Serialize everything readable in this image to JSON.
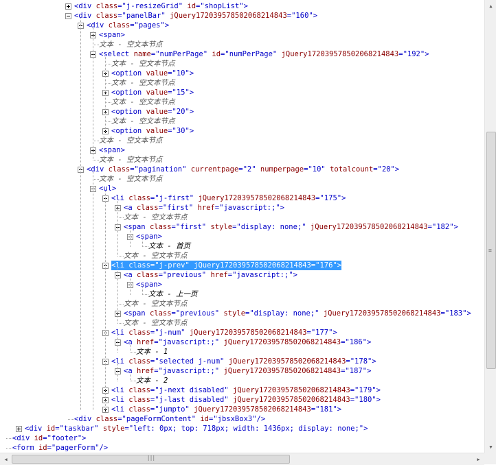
{
  "tree_rows": [
    {
      "d": 5,
      "btn": "col",
      "p": [
        [
          "tg",
          "<div "
        ],
        [
          "an",
          "class"
        ],
        [
          "tg",
          "="
        ],
        [
          "av",
          "\"j-resizeGrid\""
        ],
        [
          "tg",
          " "
        ],
        [
          "an",
          "id"
        ],
        [
          "tg",
          "="
        ],
        [
          "av",
          "\"shopList\""
        ],
        [
          "tg",
          ">"
        ]
      ]
    },
    {
      "d": 5,
      "btn": "exp",
      "p": [
        [
          "tg",
          "<div "
        ],
        [
          "an",
          "class"
        ],
        [
          "tg",
          "="
        ],
        [
          "av",
          "\"panelBar\""
        ],
        [
          "tg",
          " "
        ],
        [
          "an",
          "jQuery172039578502068214843"
        ],
        [
          "tg",
          "="
        ],
        [
          "av",
          "\"160\""
        ],
        [
          "tg",
          ">"
        ]
      ]
    },
    {
      "d": 6,
      "btn": "exp",
      "p": [
        [
          "tg",
          "<div "
        ],
        [
          "an",
          "class"
        ],
        [
          "tg",
          "="
        ],
        [
          "av",
          "\"pages\""
        ],
        [
          "tg",
          ">"
        ]
      ]
    },
    {
      "d": 7,
      "btn": "col",
      "p": [
        [
          "tg",
          "<span>"
        ]
      ]
    },
    {
      "d": 7,
      "btn": "",
      "p": [
        [
          "tn",
          "文本 - 空文本节点"
        ]
      ]
    },
    {
      "d": 7,
      "btn": "exp",
      "p": [
        [
          "tg",
          "<select "
        ],
        [
          "an",
          "name"
        ],
        [
          "tg",
          "="
        ],
        [
          "av",
          "\"numPerPage\""
        ],
        [
          "tg",
          " "
        ],
        [
          "an",
          "id"
        ],
        [
          "tg",
          "="
        ],
        [
          "av",
          "\"numPerPage\""
        ],
        [
          "tg",
          " "
        ],
        [
          "an",
          "jQuery172039578502068214843"
        ],
        [
          "tg",
          "="
        ],
        [
          "av",
          "\"192\""
        ],
        [
          "tg",
          ">"
        ]
      ]
    },
    {
      "d": 8,
      "btn": "",
      "p": [
        [
          "tn",
          "文本 - 空文本节点"
        ]
      ]
    },
    {
      "d": 8,
      "btn": "col",
      "p": [
        [
          "tg",
          "<option "
        ],
        [
          "an",
          "value"
        ],
        [
          "tg",
          "="
        ],
        [
          "av",
          "\"10\""
        ],
        [
          "tg",
          ">"
        ]
      ]
    },
    {
      "d": 8,
      "btn": "",
      "p": [
        [
          "tn",
          "文本 - 空文本节点"
        ]
      ]
    },
    {
      "d": 8,
      "btn": "col",
      "p": [
        [
          "tg",
          "<option "
        ],
        [
          "an",
          "value"
        ],
        [
          "tg",
          "="
        ],
        [
          "av",
          "\"15\""
        ],
        [
          "tg",
          ">"
        ]
      ]
    },
    {
      "d": 8,
      "btn": "",
      "p": [
        [
          "tn",
          "文本 - 空文本节点"
        ]
      ]
    },
    {
      "d": 8,
      "btn": "col",
      "p": [
        [
          "tg",
          "<option "
        ],
        [
          "an",
          "value"
        ],
        [
          "tg",
          "="
        ],
        [
          "av",
          "\"20\""
        ],
        [
          "tg",
          ">"
        ]
      ]
    },
    {
      "d": 8,
      "btn": "",
      "p": [
        [
          "tn",
          "文本 - 空文本节点"
        ]
      ]
    },
    {
      "d": 8,
      "btn": "col",
      "p": [
        [
          "tg",
          "<option "
        ],
        [
          "an",
          "value"
        ],
        [
          "tg",
          "="
        ],
        [
          "av",
          "\"30\""
        ],
        [
          "tg",
          ">"
        ]
      ]
    },
    {
      "d": 7,
      "btn": "",
      "p": [
        [
          "tn",
          "文本 - 空文本节点"
        ]
      ]
    },
    {
      "d": 7,
      "btn": "col",
      "p": [
        [
          "tg",
          "<span>"
        ]
      ]
    },
    {
      "d": 7,
      "btn": "",
      "p": [
        [
          "tn",
          "文本 - 空文本节点"
        ]
      ]
    },
    {
      "d": 6,
      "btn": "exp",
      "p": [
        [
          "tg",
          "<div "
        ],
        [
          "an",
          "class"
        ],
        [
          "tg",
          "="
        ],
        [
          "av",
          "\"pagination\""
        ],
        [
          "tg",
          " "
        ],
        [
          "an",
          "currentpage"
        ],
        [
          "tg",
          "="
        ],
        [
          "av",
          "\"2\""
        ],
        [
          "tg",
          " "
        ],
        [
          "an",
          "numperpage"
        ],
        [
          "tg",
          "="
        ],
        [
          "av",
          "\"10\""
        ],
        [
          "tg",
          " "
        ],
        [
          "an",
          "totalcount"
        ],
        [
          "tg",
          "="
        ],
        [
          "av",
          "\"20\""
        ],
        [
          "tg",
          ">"
        ]
      ]
    },
    {
      "d": 7,
      "btn": "",
      "p": [
        [
          "tn",
          "文本 - 空文本节点"
        ]
      ]
    },
    {
      "d": 7,
      "btn": "exp",
      "p": [
        [
          "tg",
          "<ul>"
        ]
      ]
    },
    {
      "d": 8,
      "btn": "exp",
      "p": [
        [
          "tg",
          "<li "
        ],
        [
          "an",
          "class"
        ],
        [
          "tg",
          "="
        ],
        [
          "av",
          "\"j-first\""
        ],
        [
          "tg",
          " "
        ],
        [
          "an",
          "jQuery172039578502068214843"
        ],
        [
          "tg",
          "="
        ],
        [
          "av",
          "\"175\""
        ],
        [
          "tg",
          ">"
        ]
      ]
    },
    {
      "d": 9,
      "btn": "col",
      "p": [
        [
          "tg",
          "<a "
        ],
        [
          "an",
          "class"
        ],
        [
          "tg",
          "="
        ],
        [
          "av",
          "\"first\""
        ],
        [
          "tg",
          " "
        ],
        [
          "an",
          "href"
        ],
        [
          "tg",
          "="
        ],
        [
          "av",
          "\"javascript:;\""
        ],
        [
          "tg",
          ">"
        ]
      ]
    },
    {
      "d": 9,
      "btn": "",
      "p": [
        [
          "tn",
          "文本 - 空文本节点"
        ]
      ]
    },
    {
      "d": 9,
      "btn": "exp",
      "p": [
        [
          "tg",
          "<span "
        ],
        [
          "an",
          "class"
        ],
        [
          "tg",
          "="
        ],
        [
          "av",
          "\"first\""
        ],
        [
          "tg",
          " "
        ],
        [
          "an",
          "style"
        ],
        [
          "tg",
          "="
        ],
        [
          "av",
          "\"display: none;\""
        ],
        [
          "tg",
          " "
        ],
        [
          "an",
          "jQuery172039578502068214843"
        ],
        [
          "tg",
          "="
        ],
        [
          "av",
          "\"182\""
        ],
        [
          "tg",
          ">"
        ]
      ]
    },
    {
      "d": 10,
      "btn": "exp",
      "p": [
        [
          "tg",
          "<span>"
        ]
      ]
    },
    {
      "d": 11,
      "btn": "",
      "p": [
        [
          "tx",
          "文本 - 首页"
        ]
      ]
    },
    {
      "d": 9,
      "btn": "",
      "p": [
        [
          "tn",
          "文本 - 空文本节点"
        ]
      ]
    },
    {
      "d": 8,
      "btn": "exp",
      "sel": true,
      "p": [
        [
          "tg",
          "<li "
        ],
        [
          "an",
          "class"
        ],
        [
          "tg",
          "="
        ],
        [
          "av",
          "\"j-prev\""
        ],
        [
          "tg",
          " "
        ],
        [
          "an",
          "jQuery172039578502068214843"
        ],
        [
          "tg",
          "="
        ],
        [
          "av",
          "\"176\""
        ],
        [
          "tg",
          ">"
        ]
      ]
    },
    {
      "d": 9,
      "btn": "exp",
      "p": [
        [
          "tg",
          "<a "
        ],
        [
          "an",
          "class"
        ],
        [
          "tg",
          "="
        ],
        [
          "av",
          "\"previous\""
        ],
        [
          "tg",
          " "
        ],
        [
          "an",
          "href"
        ],
        [
          "tg",
          "="
        ],
        [
          "av",
          "\"javascript:;\""
        ],
        [
          "tg",
          ">"
        ]
      ]
    },
    {
      "d": 10,
      "btn": "exp",
      "p": [
        [
          "tg",
          "<span>"
        ]
      ]
    },
    {
      "d": 11,
      "btn": "",
      "p": [
        [
          "tx",
          "文本 - 上一页"
        ]
      ]
    },
    {
      "d": 9,
      "btn": "",
      "p": [
        [
          "tn",
          "文本 - 空文本节点"
        ]
      ]
    },
    {
      "d": 9,
      "btn": "col",
      "p": [
        [
          "tg",
          "<span "
        ],
        [
          "an",
          "class"
        ],
        [
          "tg",
          "="
        ],
        [
          "av",
          "\"previous\""
        ],
        [
          "tg",
          " "
        ],
        [
          "an",
          "style"
        ],
        [
          "tg",
          "="
        ],
        [
          "av",
          "\"display: none;\""
        ],
        [
          "tg",
          " "
        ],
        [
          "an",
          "jQuery172039578502068214843"
        ],
        [
          "tg",
          "="
        ],
        [
          "av",
          "\"183\""
        ],
        [
          "tg",
          ">"
        ]
      ]
    },
    {
      "d": 9,
      "btn": "",
      "p": [
        [
          "tn",
          "文本 - 空文本节点"
        ]
      ]
    },
    {
      "d": 8,
      "btn": "exp",
      "p": [
        [
          "tg",
          "<li "
        ],
        [
          "an",
          "class"
        ],
        [
          "tg",
          "="
        ],
        [
          "av",
          "\"j-num\""
        ],
        [
          "tg",
          " "
        ],
        [
          "an",
          "jQuery172039578502068214843"
        ],
        [
          "tg",
          "="
        ],
        [
          "av",
          "\"177\""
        ],
        [
          "tg",
          ">"
        ]
      ]
    },
    {
      "d": 9,
      "btn": "exp",
      "p": [
        [
          "tg",
          "<a "
        ],
        [
          "an",
          "href"
        ],
        [
          "tg",
          "="
        ],
        [
          "av",
          "\"javascript:;\""
        ],
        [
          "tg",
          " "
        ],
        [
          "an",
          "jQuery172039578502068214843"
        ],
        [
          "tg",
          "="
        ],
        [
          "av",
          "\"186\""
        ],
        [
          "tg",
          ">"
        ]
      ]
    },
    {
      "d": 10,
      "btn": "",
      "p": [
        [
          "tx",
          "文本 - 1"
        ]
      ]
    },
    {
      "d": 8,
      "btn": "exp",
      "p": [
        [
          "tg",
          "<li "
        ],
        [
          "an",
          "class"
        ],
        [
          "tg",
          "="
        ],
        [
          "av",
          "\"selected j-num\""
        ],
        [
          "tg",
          " "
        ],
        [
          "an",
          "jQuery172039578502068214843"
        ],
        [
          "tg",
          "="
        ],
        [
          "av",
          "\"178\""
        ],
        [
          "tg",
          ">"
        ]
      ]
    },
    {
      "d": 9,
      "btn": "exp",
      "p": [
        [
          "tg",
          "<a "
        ],
        [
          "an",
          "href"
        ],
        [
          "tg",
          "="
        ],
        [
          "av",
          "\"javascript:;\""
        ],
        [
          "tg",
          " "
        ],
        [
          "an",
          "jQuery172039578502068214843"
        ],
        [
          "tg",
          "="
        ],
        [
          "av",
          "\"187\""
        ],
        [
          "tg",
          ">"
        ]
      ]
    },
    {
      "d": 10,
      "btn": "",
      "p": [
        [
          "tx",
          "文本 - 2"
        ]
      ]
    },
    {
      "d": 8,
      "btn": "col",
      "p": [
        [
          "tg",
          "<li "
        ],
        [
          "an",
          "class"
        ],
        [
          "tg",
          "="
        ],
        [
          "av",
          "\"j-next disabled\""
        ],
        [
          "tg",
          " "
        ],
        [
          "an",
          "jQuery172039578502068214843"
        ],
        [
          "tg",
          "="
        ],
        [
          "av",
          "\"179\""
        ],
        [
          "tg",
          ">"
        ]
      ]
    },
    {
      "d": 8,
      "btn": "col",
      "p": [
        [
          "tg",
          "<li "
        ],
        [
          "an",
          "class"
        ],
        [
          "tg",
          "="
        ],
        [
          "av",
          "\"j-last disabled\""
        ],
        [
          "tg",
          " "
        ],
        [
          "an",
          "jQuery172039578502068214843"
        ],
        [
          "tg",
          "="
        ],
        [
          "av",
          "\"180\""
        ],
        [
          "tg",
          ">"
        ]
      ]
    },
    {
      "d": 8,
      "btn": "col",
      "p": [
        [
          "tg",
          "<li "
        ],
        [
          "an",
          "class"
        ],
        [
          "tg",
          "="
        ],
        [
          "av",
          "\"jumpto\""
        ],
        [
          "tg",
          " "
        ],
        [
          "an",
          "jQuery172039578502068214843"
        ],
        [
          "tg",
          "="
        ],
        [
          "av",
          "\"181\""
        ],
        [
          "tg",
          ">"
        ]
      ]
    },
    {
      "d": 5,
      "btn": "",
      "p": [
        [
          "tg",
          "<div "
        ],
        [
          "an",
          "class"
        ],
        [
          "tg",
          "="
        ],
        [
          "av",
          "\"pageFormContent\""
        ],
        [
          "tg",
          " "
        ],
        [
          "an",
          "id"
        ],
        [
          "tg",
          "="
        ],
        [
          "av",
          "\"jbsxBox3\""
        ],
        [
          "tg",
          "/>"
        ]
      ]
    },
    {
      "d": 1,
      "btn": "col",
      "p": [
        [
          "tg",
          "<div "
        ],
        [
          "an",
          "id"
        ],
        [
          "tg",
          "="
        ],
        [
          "av",
          "\"taskbar\""
        ],
        [
          "tg",
          " "
        ],
        [
          "an",
          "style"
        ],
        [
          "tg",
          "="
        ],
        [
          "av",
          "\"left: 0px; top: 718px; width: 1436px; display: none;\""
        ],
        [
          "tg",
          ">"
        ]
      ]
    },
    {
      "d": 0,
      "btn": "",
      "p": [
        [
          "tg",
          "<div "
        ],
        [
          "an",
          "id"
        ],
        [
          "tg",
          "="
        ],
        [
          "av",
          "\"footer\""
        ],
        [
          "tg",
          ">"
        ]
      ]
    },
    {
      "d": 0,
      "btn": "",
      "p": [
        [
          "tg",
          "<form "
        ],
        [
          "an",
          "id"
        ],
        [
          "tg",
          "="
        ],
        [
          "av",
          "\"pagerForm\""
        ],
        [
          "tg",
          "/>"
        ]
      ]
    }
  ],
  "scrollbars": {
    "vertical": {
      "up_icon": "arrow-up-icon",
      "down_icon": "arrow-down-icon",
      "position": 0.62,
      "thumb_fraction": 0.55
    },
    "horizontal": {
      "left_icon": "arrow-left-icon",
      "right_icon": "arrow-right-icon",
      "position": 0.0,
      "thumb_fraction": 0.6
    }
  },
  "colors": {
    "tag": "#0000c8",
    "attr_name": "#8b0000",
    "attr_value": "#0000c8",
    "selection": "#3399ff"
  }
}
